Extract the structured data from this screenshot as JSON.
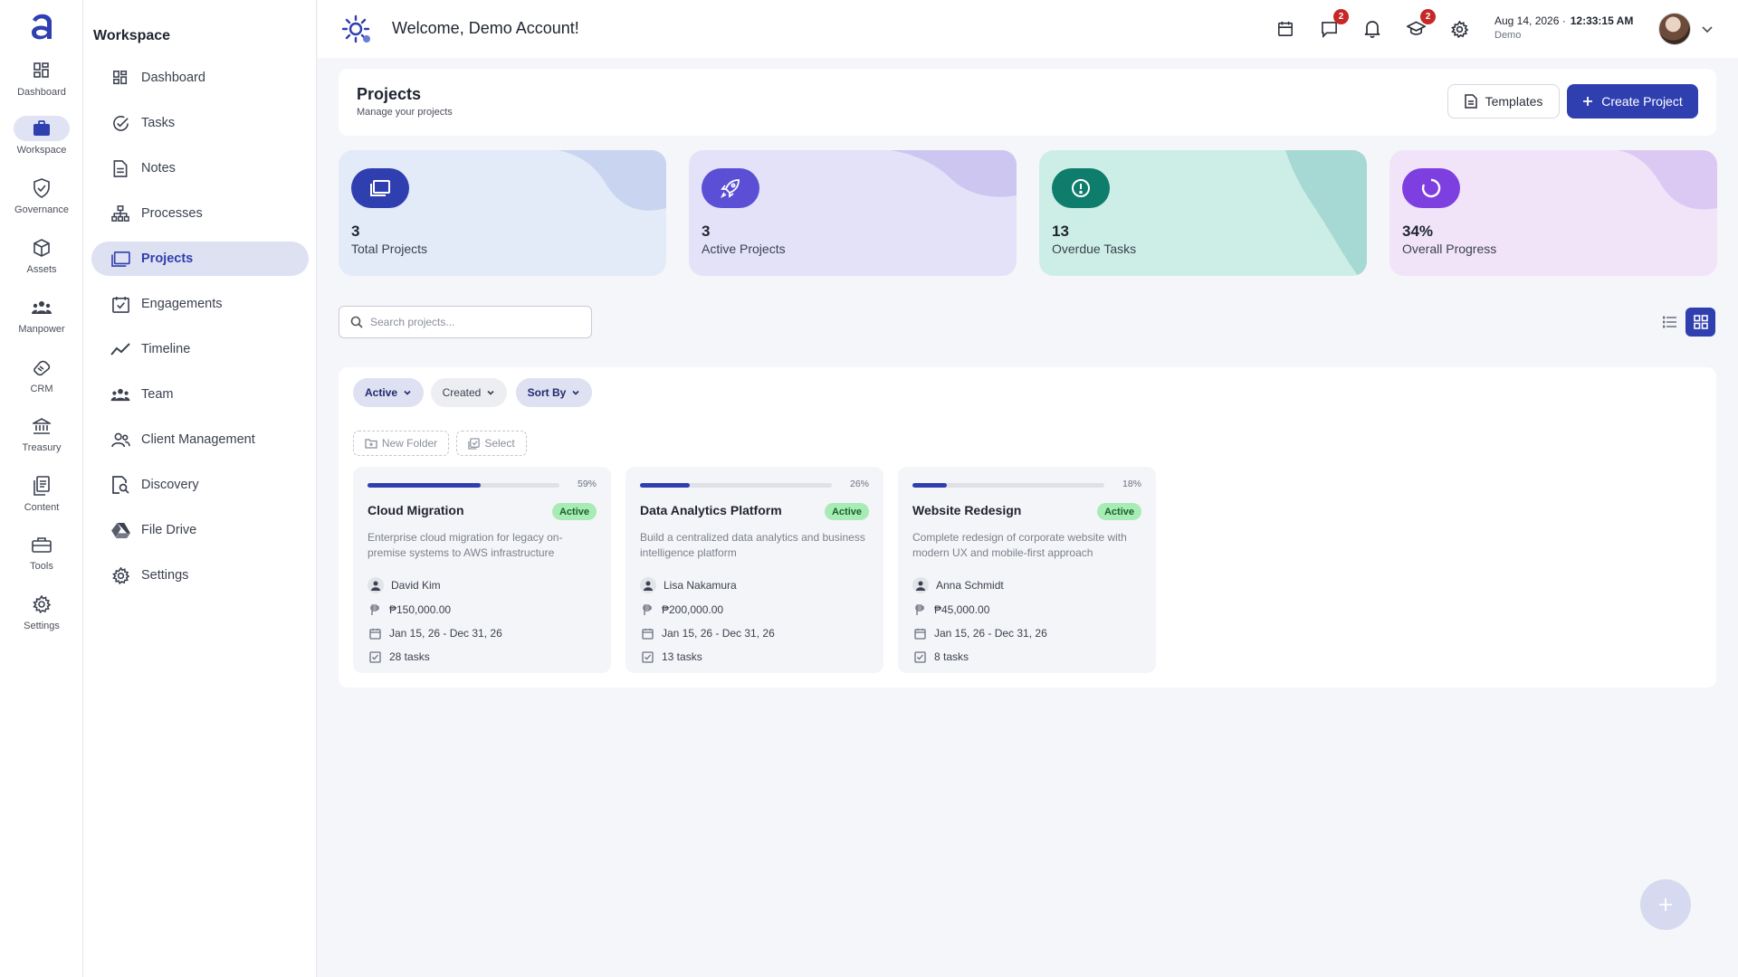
{
  "rail": {
    "items": [
      {
        "label": "Dashboard",
        "icon": "grid-icon"
      },
      {
        "label": "Workspace",
        "icon": "briefcase-icon",
        "active": true
      },
      {
        "label": "Governance",
        "icon": "shield-check-icon"
      },
      {
        "label": "Assets",
        "icon": "cube-icon"
      },
      {
        "label": "Manpower",
        "icon": "people-icon"
      },
      {
        "label": "CRM",
        "icon": "handshake-icon"
      },
      {
        "label": "Treasury",
        "icon": "bank-icon"
      },
      {
        "label": "Content",
        "icon": "documents-icon"
      },
      {
        "label": "Tools",
        "icon": "toolbox-icon"
      },
      {
        "label": "Settings",
        "icon": "gear-icon"
      }
    ]
  },
  "sidebar": {
    "title": "Workspace",
    "items": [
      {
        "label": "Dashboard",
        "icon": "grid-icon"
      },
      {
        "label": "Tasks",
        "icon": "check-circle-icon"
      },
      {
        "label": "Notes",
        "icon": "note-icon"
      },
      {
        "label": "Processes",
        "icon": "hierarchy-icon"
      },
      {
        "label": "Projects",
        "icon": "folders-icon",
        "active": true
      },
      {
        "label": "Engagements",
        "icon": "calendar-check-icon"
      },
      {
        "label": "Timeline",
        "icon": "trend-line-icon"
      },
      {
        "label": "Team",
        "icon": "people-icon"
      },
      {
        "label": "Client Management",
        "icon": "clients-icon"
      },
      {
        "label": "Discovery",
        "icon": "search-document-icon"
      },
      {
        "label": "File Drive",
        "icon": "drive-icon"
      },
      {
        "label": "Settings",
        "icon": "gear-icon"
      }
    ]
  },
  "header": {
    "welcome": "Welcome, Demo Account!",
    "messages_badge": "2",
    "training_badge": "2",
    "date": "Aug 14, 2026 ·",
    "time": "12:33:15 AM",
    "user": "Demo"
  },
  "projects_header": {
    "title": "Projects",
    "subtitle": "Manage your projects",
    "templates_label": "Templates",
    "create_label": "Create Project"
  },
  "stats": [
    {
      "value": "3",
      "label": "Total Projects",
      "bg": "#e3ebf8",
      "blob": "#c9d4f0",
      "icon_bg": "#2f3fb0"
    },
    {
      "value": "3",
      "label": "Active Projects",
      "bg": "#e4e2f8",
      "blob": "#cdc6f1",
      "icon_bg": "#5b4fd6"
    },
    {
      "value": "13",
      "label": "Overdue Tasks",
      "bg": "#cdeee6",
      "blob": "#a6d9d3",
      "icon_bg": "#0e7d6c"
    },
    {
      "value": "34%",
      "label": "Overall Progress",
      "bg": "#f1e4f9",
      "blob": "#dcc9f3",
      "icon_bg": "#7e3fe0"
    }
  ],
  "search": {
    "placeholder": "Search projects..."
  },
  "filters": {
    "status": "Active",
    "created": "Created",
    "sort": "Sort By",
    "new_folder": "New Folder",
    "select": "Select"
  },
  "projects": [
    {
      "progress": 0.59,
      "progress_label": "59%",
      "name": "Cloud Migration",
      "status": "Active",
      "description": "Enterprise cloud migration for legacy on-premise systems to AWS infrastructure",
      "owner": "David Kim",
      "budget": "₱150,000.00",
      "dates": "Jan 15, 26 - Dec 31, 26",
      "tasks": "28 tasks"
    },
    {
      "progress": 0.26,
      "progress_label": "26%",
      "name": "Data Analytics Platform",
      "status": "Active",
      "description": "Build a centralized data analytics and business intelligence platform",
      "owner": "Lisa Nakamura",
      "budget": "₱200,000.00",
      "dates": "Jan 15, 26 - Dec 31, 26",
      "tasks": "13 tasks"
    },
    {
      "progress": 0.18,
      "progress_label": "18%",
      "name": "Website Redesign",
      "status": "Active",
      "description": "Complete redesign of corporate website with modern UX and mobile-first approach",
      "owner": "Anna Schmidt",
      "budget": "₱45,000.00",
      "dates": "Jan 15, 26 - Dec 31, 26",
      "tasks": "8 tasks"
    }
  ],
  "colors": {
    "primary": "#2f3fb0",
    "success_bg": "#a8ebb4",
    "success_text": "#17602a"
  }
}
